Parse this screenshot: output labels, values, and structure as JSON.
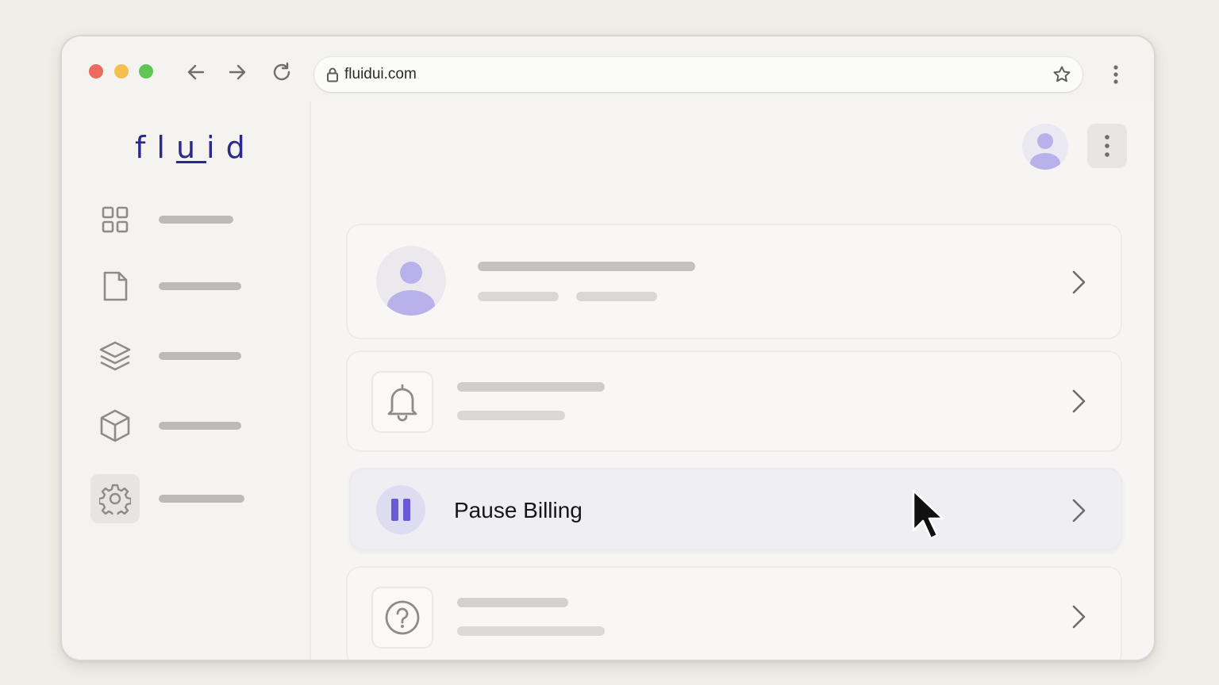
{
  "browser": {
    "url": "fluidui.com",
    "icons": [
      "back-arrow-icon",
      "forward-arrow-icon",
      "reload-icon",
      "lock-icon",
      "star-icon",
      "kebab-menu-icon"
    ]
  },
  "sidebar": {
    "logo": "fluid",
    "items": [
      {
        "icon": "grid-icon"
      },
      {
        "icon": "document-icon"
      },
      {
        "icon": "layers-icon"
      },
      {
        "icon": "cube-icon"
      },
      {
        "icon": "gear-icon",
        "active": true
      }
    ]
  },
  "main": {
    "cards": [
      {
        "icon": "user-avatar-icon"
      },
      {
        "icon": "bell-icon"
      },
      {
        "icon": "pause-icon",
        "label": "Pause Billing",
        "highlighted": true
      },
      {
        "icon": "help-icon"
      }
    ]
  },
  "colors": {
    "background": "#efede6",
    "logo": "#2b2a8c",
    "accent": "#6a5ad8",
    "avatar": "#b9b2ea",
    "placeholder": "#c7c5c1",
    "traffic_red": "#ec6a5e",
    "traffic_yellow": "#f4bf4f",
    "traffic_green": "#61c554"
  }
}
